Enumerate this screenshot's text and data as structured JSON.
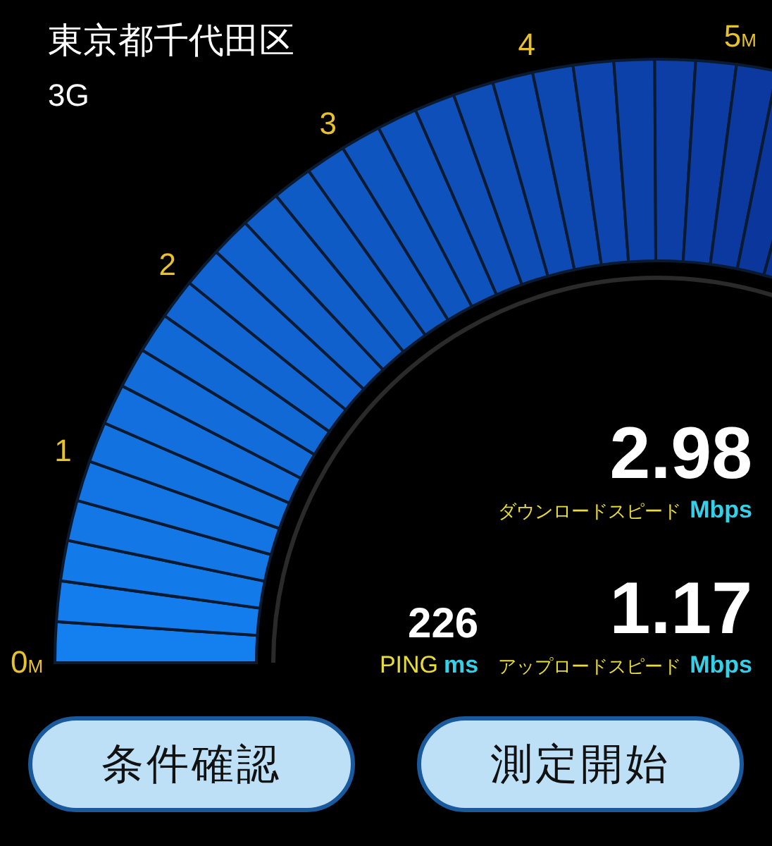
{
  "location": "東京都千代田区",
  "network": "3G",
  "scale": [
    {
      "label": "0",
      "unit": "M"
    },
    {
      "label": "1"
    },
    {
      "label": "2"
    },
    {
      "label": "3"
    },
    {
      "label": "4"
    },
    {
      "label": "5",
      "unit": "M"
    }
  ],
  "ping": {
    "value": "226",
    "label": "PING",
    "unit": "ms"
  },
  "results": [
    {
      "value": "2.98",
      "label": "ダウンロードスピード",
      "unit": "Mbps"
    },
    {
      "value": "1.17",
      "label": "アップロードスピード",
      "unit": "Mbps"
    }
  ],
  "buttons": [
    "条件確認",
    "測定開始"
  ]
}
